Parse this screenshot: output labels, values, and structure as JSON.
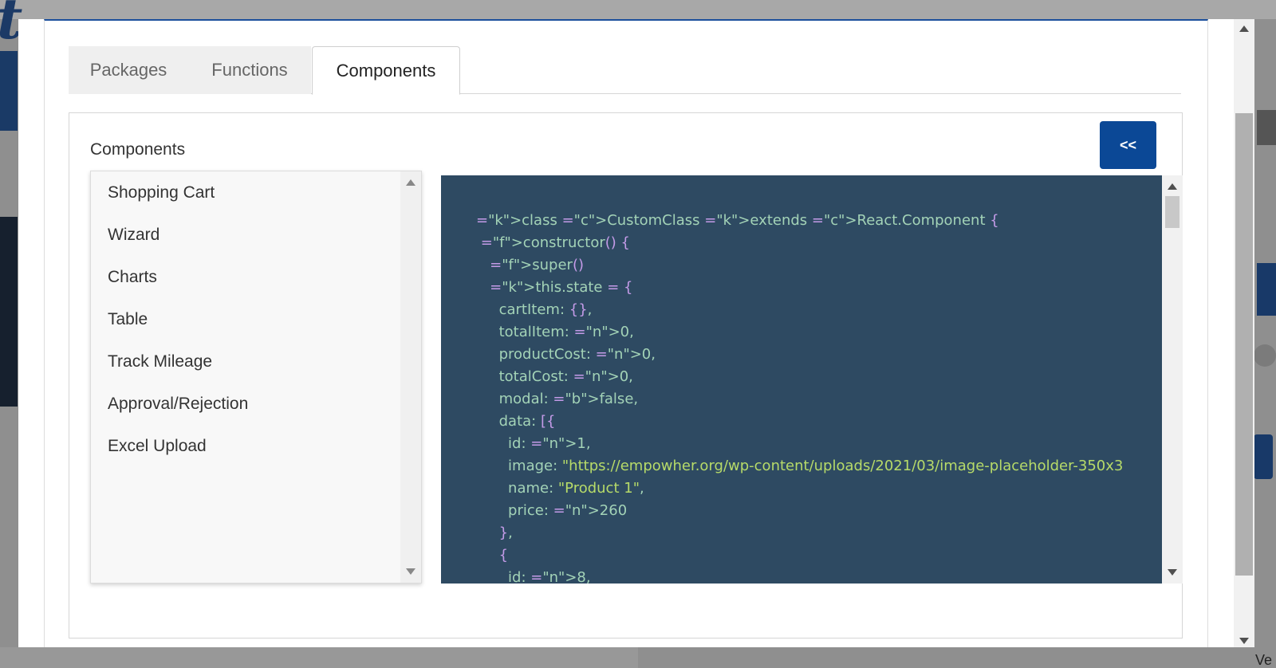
{
  "background": {
    "bottom_text": "Ve"
  },
  "tabs": [
    {
      "label": "Packages",
      "active": false
    },
    {
      "label": "Functions",
      "active": false
    },
    {
      "label": "Components",
      "active": true
    }
  ],
  "panel": {
    "title": "Components",
    "toggle_label": "<<"
  },
  "components_list": [
    "Shopping Cart",
    "Wizard",
    "Charts",
    "Table",
    "Track Mileage",
    "Approval/Rejection",
    "Excel Upload"
  ],
  "code_lines": [
    "class CustomClass extends React.Component {",
    " constructor() {",
    "   super()",
    "   this.state = {",
    "     cartItem: {},",
    "     totalItem: 0,",
    "     productCost: 0,",
    "     totalCost: 0,",
    "     modal: false,",
    "     data: [{",
    "       id: 1,",
    "       image: \"https://empowher.org/wp-content/uploads/2021/03/image-placeholder-350x3",
    "       name: \"Product 1\",",
    "       price: 260",
    "     },",
    "     {",
    "       id: 8,"
  ],
  "colors": {
    "accent": "#0b4896",
    "code_background": "#2e4a62"
  },
  "icons": {
    "scroll_up": "triangle-up",
    "scroll_down": "triangle-down"
  }
}
